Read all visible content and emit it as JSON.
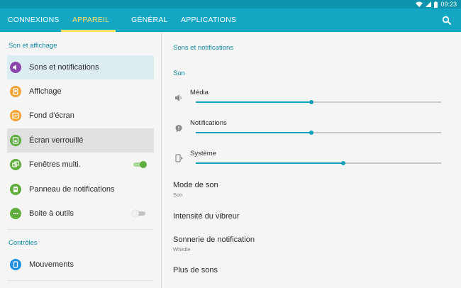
{
  "status_bar": {
    "time": "09:23"
  },
  "tabs": [
    {
      "label": "CONNEXIONS",
      "active": false
    },
    {
      "label": "APPAREIL",
      "active": true
    },
    {
      "label": "GÉNÉRAL",
      "active": false
    },
    {
      "label": "APPLICATIONS",
      "active": false
    }
  ],
  "sidebar": {
    "section1": "Son et affichage",
    "items": [
      {
        "label": "Sons et notifications",
        "icon": "speaker-icon",
        "icon_color": "#8e44ad"
      },
      {
        "label": "Affichage",
        "icon": "display-icon",
        "icon_color": "#f4a233"
      },
      {
        "label": "Fond d'écran",
        "icon": "wallpaper-icon",
        "icon_color": "#f4a233"
      },
      {
        "label": "Écran verrouillé",
        "icon": "lockscreen-icon",
        "icon_color": "#5fae3d"
      },
      {
        "label": "Fenêtres multi.",
        "icon": "multiwindow-icon",
        "icon_color": "#5fae3d",
        "toggle": true
      },
      {
        "label": "Panneau de notifications",
        "icon": "notification-panel-icon",
        "icon_color": "#5fae3d"
      },
      {
        "label": "Boite à outils",
        "icon": "toolbox-icon",
        "icon_color": "#5fae3d",
        "toggle": false
      }
    ],
    "section2": "Contrôles",
    "items2": [
      {
        "label": "Mouvements",
        "icon": "motion-icon",
        "icon_color": "#1f8fe0"
      }
    ]
  },
  "main": {
    "title": "Sons et notifications",
    "subtitle": "Son",
    "volumes": [
      {
        "label": "Média",
        "icon": "speaker-icon",
        "level": 0.47
      },
      {
        "label": "Notifications",
        "icon": "notification-bubble-icon",
        "level": 0.47
      },
      {
        "label": "Système",
        "icon": "phone-vibrate-icon",
        "level": 0.6
      }
    ],
    "settings": [
      {
        "title": "Mode de son",
        "subtitle": "Son"
      },
      {
        "title": "Intensité du vibreur",
        "subtitle": ""
      },
      {
        "title": "Sonnerie de notification",
        "subtitle": "Whistle"
      },
      {
        "title": "Plus de sons",
        "subtitle": ""
      }
    ]
  },
  "colors": {
    "accent": "#13a7c4",
    "tab_active": "#ffe36b",
    "toggle_on": "#5fae3d"
  }
}
